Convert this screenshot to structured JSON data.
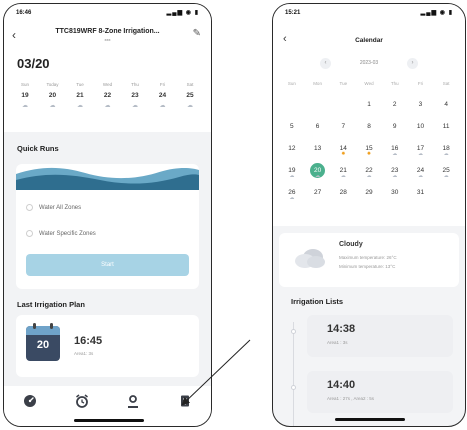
{
  "left_phone": {
    "status_time": "16:46",
    "status_icons": "▂▄▆ ◉ ▮",
    "nav": {
      "back_glyph": "‹",
      "title": "TTC819WRF 8-Zone Irrigation...",
      "subtitle": "xxx",
      "edit_glyph": "✎"
    },
    "date": "03/20",
    "week": [
      {
        "day": "Sun",
        "date": "19",
        "weather": "☁"
      },
      {
        "day": "Today",
        "date": "20",
        "weather": "☁"
      },
      {
        "day": "Tue",
        "date": "21",
        "weather": "☁"
      },
      {
        "day": "Wed",
        "date": "22",
        "weather": "☁"
      },
      {
        "day": "Thu",
        "date": "23",
        "weather": "☁"
      },
      {
        "day": "Fri",
        "date": "24",
        "weather": "☁"
      },
      {
        "day": "Sat",
        "date": "25",
        "weather": "☁"
      }
    ],
    "quick_runs": {
      "title": "Quick Runs",
      "option_all": "Water All Zones",
      "option_specific": "Water Specific Zones",
      "start_label": "Start"
    },
    "last_plan": {
      "title": "Last Irrigation Plan",
      "calendar_day": "20",
      "time": "16:45",
      "detail": "Area1: 3s"
    },
    "tabs": [
      {
        "name": "tab-home",
        "icon": "gauge-icon"
      },
      {
        "name": "tab-timer",
        "icon": "alarm-clock-icon"
      },
      {
        "name": "tab-profile",
        "icon": "person-icon"
      },
      {
        "name": "tab-records",
        "icon": "document-icon"
      }
    ]
  },
  "right_phone": {
    "status_time": "15:21",
    "status_icons": "▂▄▆ ◉ ▮",
    "back_glyph": "‹",
    "title": "Calendar",
    "month": "2023-03",
    "prev_glyph": "‹",
    "next_glyph": "›",
    "weekdays": [
      "Sun",
      "Mon",
      "Tue",
      "Wed",
      "Thu",
      "Fri",
      "Sat"
    ],
    "rows": [
      [
        {
          "n": "",
          "w": ""
        },
        {
          "n": "",
          "w": ""
        },
        {
          "n": "",
          "w": ""
        },
        {
          "n": "1",
          "w": ""
        },
        {
          "n": "2",
          "w": ""
        },
        {
          "n": "3",
          "w": ""
        },
        {
          "n": "4",
          "w": ""
        }
      ],
      [
        {
          "n": "5",
          "w": ""
        },
        {
          "n": "6",
          "w": ""
        },
        {
          "n": "7",
          "w": ""
        },
        {
          "n": "8",
          "w": ""
        },
        {
          "n": "9",
          "w": ""
        },
        {
          "n": "10",
          "w": ""
        },
        {
          "n": "11",
          "w": ""
        }
      ],
      [
        {
          "n": "12",
          "w": ""
        },
        {
          "n": "13",
          "w": ""
        },
        {
          "n": "14",
          "w": "✹"
        },
        {
          "n": "15",
          "w": "✹"
        },
        {
          "n": "16",
          "w": "☁"
        },
        {
          "n": "17",
          "w": "☁"
        },
        {
          "n": "18",
          "w": "☁"
        }
      ],
      [
        {
          "n": "19",
          "w": "☁"
        },
        {
          "n": "20",
          "w": "☁",
          "selected": true
        },
        {
          "n": "21",
          "w": "☁"
        },
        {
          "n": "22",
          "w": "☁"
        },
        {
          "n": "23",
          "w": "☁"
        },
        {
          "n": "24",
          "w": "☁"
        },
        {
          "n": "25",
          "w": "☁"
        }
      ],
      [
        {
          "n": "26",
          "w": "☁"
        },
        {
          "n": "27",
          "w": ""
        },
        {
          "n": "28",
          "w": ""
        },
        {
          "n": "29",
          "w": ""
        },
        {
          "n": "30",
          "w": ""
        },
        {
          "n": "31",
          "w": ""
        },
        {
          "n": "",
          "w": ""
        }
      ]
    ],
    "weather": {
      "condition": "Cloudy",
      "max_label": "Maximum temperature:",
      "max_value": "26°C",
      "min_label": "Minimum temperature:",
      "min_value": "13°C"
    },
    "irrigation": {
      "title": "Irrigation Lists",
      "items": [
        {
          "time": "14:38",
          "detail": "Area1 : 3s"
        },
        {
          "time": "14:40",
          "detail": "Area1 : 27s ,  Area2 : 5s"
        }
      ]
    }
  },
  "colors": {
    "selected_day": "#4bb08d",
    "start_button": "#a7d3e5",
    "wave_dark": "#2f6e8f",
    "wave_light": "#6aa9c7",
    "sun": "#f0a020"
  }
}
